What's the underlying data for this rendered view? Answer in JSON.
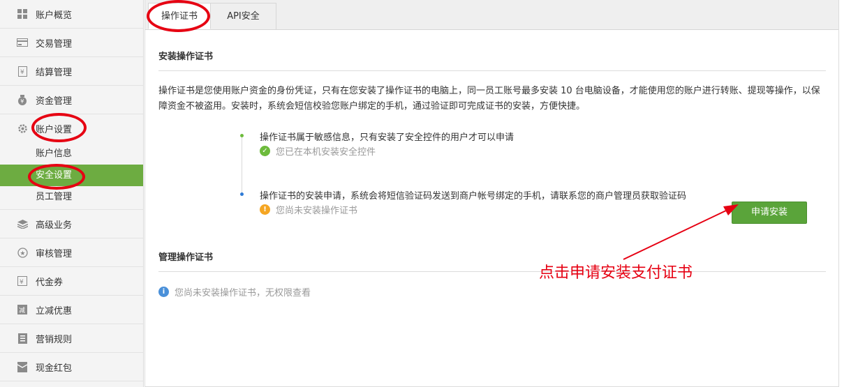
{
  "sidebar": {
    "items": [
      {
        "label": "账户概览",
        "icon": "grid-icon"
      },
      {
        "label": "交易管理",
        "icon": "card-icon"
      },
      {
        "label": "结算管理",
        "icon": "document-icon"
      },
      {
        "label": "资金管理",
        "icon": "money-bag-icon"
      },
      {
        "label": "账户设置",
        "icon": "gear-icon"
      }
    ],
    "sub_items": [
      {
        "label": "账户信息"
      },
      {
        "label": "安全设置"
      },
      {
        "label": "员工管理"
      }
    ],
    "items_after": [
      {
        "label": "高级业务",
        "icon": "layers-icon"
      },
      {
        "label": "审核管理",
        "icon": "star-icon"
      },
      {
        "label": "代金券",
        "icon": "coupon-icon"
      },
      {
        "label": "立减优惠",
        "icon": "discount-icon"
      },
      {
        "label": "营销规则",
        "icon": "list-icon"
      },
      {
        "label": "现金红包",
        "icon": "red-packet-icon"
      }
    ]
  },
  "tabs": [
    {
      "label": "操作证书",
      "active": true
    },
    {
      "label": "API安全",
      "active": false
    }
  ],
  "install_section": {
    "title": "安装操作证书",
    "description": "操作证书是您使用账户资金的身份凭证，只有在您安装了操作证书的电脑上，同一员工账号最多安装 10 台电脑设备，才能使用您的账户进行转账、提现等操作，以保障资金不被盗用。安装时，系统会短信校验您账户绑定的手机，通过验证即可完成证书的安装，方便快捷。",
    "steps": [
      {
        "text": "操作证书属于敏感信息，只有安装了安全控件的用户才可以申请",
        "status": "您已在本机安装安全控件",
        "status_type": "success"
      },
      {
        "text": "操作证书的安装申请，系统会将短信验证码发送到商户帐号绑定的手机，请联系您的商户管理员获取验证码",
        "status": "您尚未安装操作证书",
        "status_type": "warning"
      }
    ],
    "apply_button": "申请安装"
  },
  "manage_section": {
    "title": "管理操作证书",
    "info": "您尚未安装操作证书，无权限查看"
  },
  "annotation": {
    "text": "点击申请安装支付证书"
  },
  "colors": {
    "accent_green": "#6dac41",
    "button_green": "#5aa43a",
    "annotation_red": "#e60012",
    "success_green": "#6dbb3c",
    "warning_orange": "#f5a623",
    "info_blue": "#4a90d9"
  }
}
